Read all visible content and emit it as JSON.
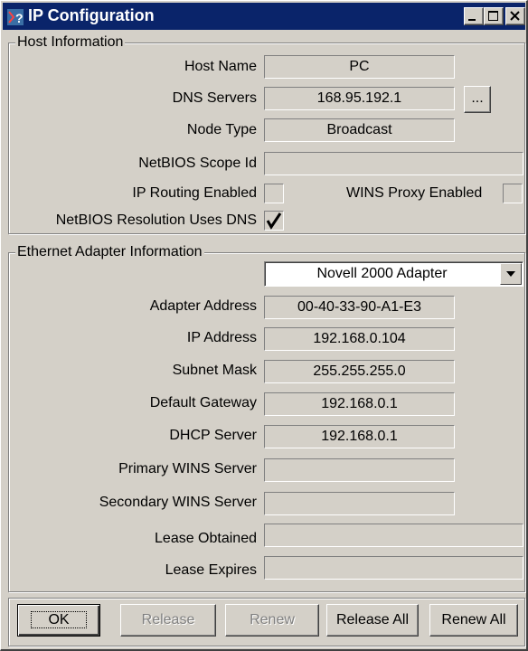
{
  "window": {
    "title": "IP Configuration",
    "icon": "ip-config-icon",
    "controls": [
      "minimize-icon",
      "maximize-icon",
      "close-icon"
    ]
  },
  "host": {
    "group_label": "Host Information",
    "host_name_label": "Host Name",
    "host_name": "PC",
    "dns_servers_label": "DNS Servers",
    "dns_servers": "168.95.192.1",
    "dns_more_label": "...",
    "node_type_label": "Node Type",
    "node_type": "Broadcast",
    "scope_id_label": "NetBIOS Scope Id",
    "scope_id": "",
    "ip_routing_label": "IP Routing Enabled",
    "ip_routing_checked": false,
    "wins_proxy_label": "WINS Proxy Enabled",
    "wins_proxy_checked": false,
    "netbios_dns_label": "NetBIOS Resolution Uses DNS",
    "netbios_dns_checked": true
  },
  "adapter": {
    "group_label": "Ethernet  Adapter Information",
    "selected_adapter": "Novell 2000 Adapter",
    "adapter_address_label": "Adapter Address",
    "adapter_address": "00-40-33-90-A1-E3",
    "ip_address_label": "IP Address",
    "ip_address": "192.168.0.104",
    "subnet_mask_label": "Subnet Mask",
    "subnet_mask": "255.255.255.0",
    "default_gateway_label": "Default Gateway",
    "default_gateway": "192.168.0.1",
    "dhcp_server_label": "DHCP Server",
    "dhcp_server": "192.168.0.1",
    "primary_wins_label": "Primary WINS Server",
    "primary_wins": "",
    "secondary_wins_label": "Secondary WINS Server",
    "secondary_wins": "",
    "lease_obtained_label": "Lease Obtained",
    "lease_obtained": "",
    "lease_expires_label": "Lease Expires",
    "lease_expires": ""
  },
  "buttons": {
    "ok": "OK",
    "release": "Release",
    "renew": "Renew",
    "release_all": "Release All",
    "renew_all": "Renew All"
  }
}
